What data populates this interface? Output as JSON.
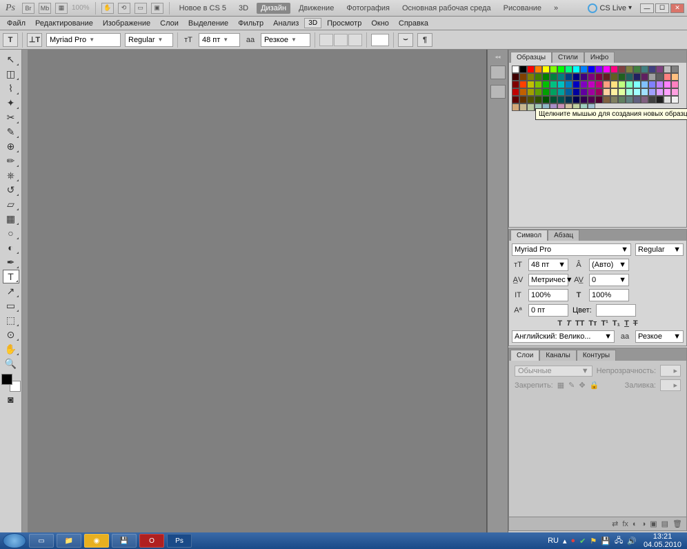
{
  "header": {
    "logo": "Ps",
    "zoom": "100%",
    "workspaces": [
      "Новое в CS 5",
      "3D",
      "Дизайн",
      "Движение",
      "Фотография",
      "Основная рабочая среда",
      "Рисование"
    ],
    "active_ws": 2,
    "more": "»",
    "cslive": "CS Live"
  },
  "winbtns": {
    "min": "—",
    "max": "☐",
    "close": "✕"
  },
  "menu": [
    "Файл",
    "Редактирование",
    "Изображение",
    "Слои",
    "Выделение",
    "Фильтр",
    "Анализ"
  ],
  "menu_btn": "3D",
  "menu2": [
    "Просмотр",
    "Окно",
    "Справка"
  ],
  "opts": {
    "font": "Myriad Pro",
    "style": "Regular",
    "size": "48 пт",
    "aa": "Резкое"
  },
  "swatches": {
    "tabs": [
      "Образцы",
      "Стили",
      "Инфо"
    ],
    "tooltip": "Щелкните мышью для создания новых образцов",
    "colors": [
      "#ffffff",
      "#000000",
      "#ff0000",
      "#ff8000",
      "#ffff00",
      "#80ff00",
      "#00ff00",
      "#00ff80",
      "#00ffff",
      "#0080ff",
      "#0000ff",
      "#8000ff",
      "#ff00ff",
      "#ff0080",
      "#804040",
      "#808040",
      "#408040",
      "#408080",
      "#404080",
      "#804080",
      "#c0c0c0",
      "#808080",
      "#400000",
      "#804000",
      "#808000",
      "#408000",
      "#008000",
      "#008040",
      "#008080",
      "#004080",
      "#000080",
      "#400080",
      "#800080",
      "#800040",
      "#602020",
      "#606020",
      "#206020",
      "#206060",
      "#202060",
      "#602060",
      "#a0a0a0",
      "#606060",
      "#ff8080",
      "#ffc080",
      "#800000",
      "#ff4000",
      "#c0c000",
      "#80c000",
      "#00c000",
      "#00c080",
      "#00c0c0",
      "#0080c0",
      "#0000c0",
      "#8000c0",
      "#c000c0",
      "#c00080",
      "#ffa080",
      "#ffe080",
      "#c0ff80",
      "#80ffc0",
      "#80ffff",
      "#80c0ff",
      "#8080ff",
      "#c080ff",
      "#ff80ff",
      "#ff80c0",
      "#c00000",
      "#c06000",
      "#a0a000",
      "#60a000",
      "#00a000",
      "#00a060",
      "#00a0a0",
      "#0060a0",
      "#0000a0",
      "#6000a0",
      "#a000a0",
      "#a00060",
      "#ffd0a0",
      "#fff0a0",
      "#e0ffa0",
      "#a0ffe0",
      "#a0ffff",
      "#a0e0ff",
      "#a0a0ff",
      "#e0a0ff",
      "#ffa0ff",
      "#ffa0e0",
      "#600000",
      "#603000",
      "#505000",
      "#305000",
      "#005000",
      "#005030",
      "#005050",
      "#003050",
      "#000050",
      "#300050",
      "#500050",
      "#500030",
      "#806040",
      "#808060",
      "#608060",
      "#608080",
      "#606080",
      "#806080",
      "#404040",
      "#202020",
      "#e0e0e0",
      "#f0f0f0",
      "#d4a878",
      "#c8b890",
      "#b8c8a0",
      "#a0c8b8",
      "#90b8c8",
      "#a890c8",
      "#c890b8",
      "#d0c0a0",
      "#c0d0a0",
      "#a0d0c0",
      "#a0c0d0"
    ]
  },
  "char": {
    "tabs": [
      "Символ",
      "Абзац"
    ],
    "font": "Myriad Pro",
    "style": "Regular",
    "size": "48 пт",
    "leading": "(Авто)",
    "kerning": "Метричес",
    "tracking": "0",
    "vscale": "100%",
    "hscale": "100%",
    "baseline": "0 пт",
    "color_lbl": "Цвет:",
    "lang": "Английский: Велико...",
    "aa": "Резкое"
  },
  "layers": {
    "tabs": [
      "Слои",
      "Каналы",
      "Контуры"
    ],
    "mode": "Обычные",
    "opacity_lbl": "Непрозрачность:",
    "lock_lbl": "Закрепить:",
    "fill_lbl": "Заливка:"
  },
  "taskbar": {
    "lang": "RU",
    "time": "13:21",
    "date": "04.05.2010"
  }
}
